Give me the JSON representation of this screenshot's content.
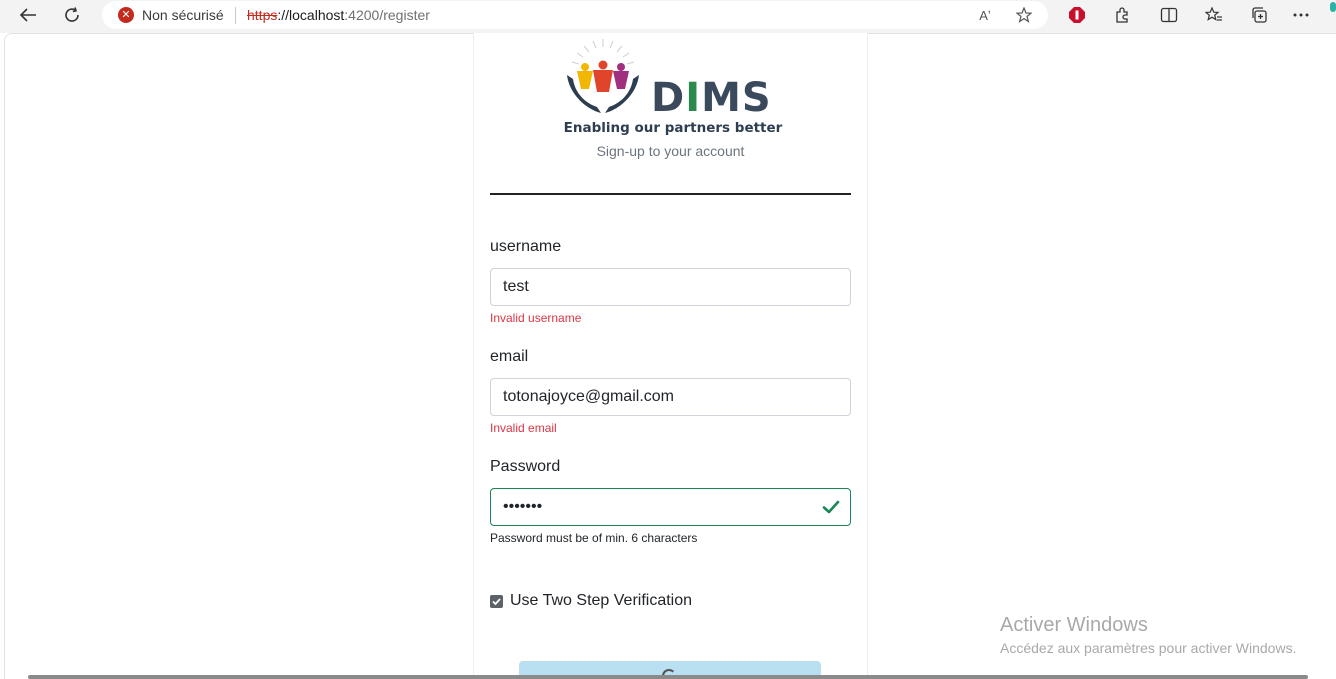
{
  "browser": {
    "security_label": "Non sécurisé",
    "url_scheme": "https",
    "url_host": "://localhost",
    "url_rest": ":4200/register",
    "read_aloud_glyph": "Aʼ"
  },
  "form": {
    "subtitle": "Sign-up to your account",
    "logo": {
      "name": "DIMS",
      "tagline": "Enabling our partners better"
    },
    "username": {
      "label": "username",
      "value": "test",
      "error": "Invalid username"
    },
    "email": {
      "label": "email",
      "value": "totonajoyce@gmail.com",
      "error": "Invalid email"
    },
    "password": {
      "label": "Password",
      "value": "•••••••",
      "hint": "Password must be of min. 6 characters"
    },
    "two_step": {
      "label": "Use Two Step Verification",
      "checked": true
    }
  },
  "watermark": {
    "title": "Activer Windows",
    "subtitle": "Accédez aux paramètres pour activer Windows."
  },
  "colors": {
    "error": "#dc3545",
    "valid": "#198754",
    "security": "#c42b1c"
  }
}
